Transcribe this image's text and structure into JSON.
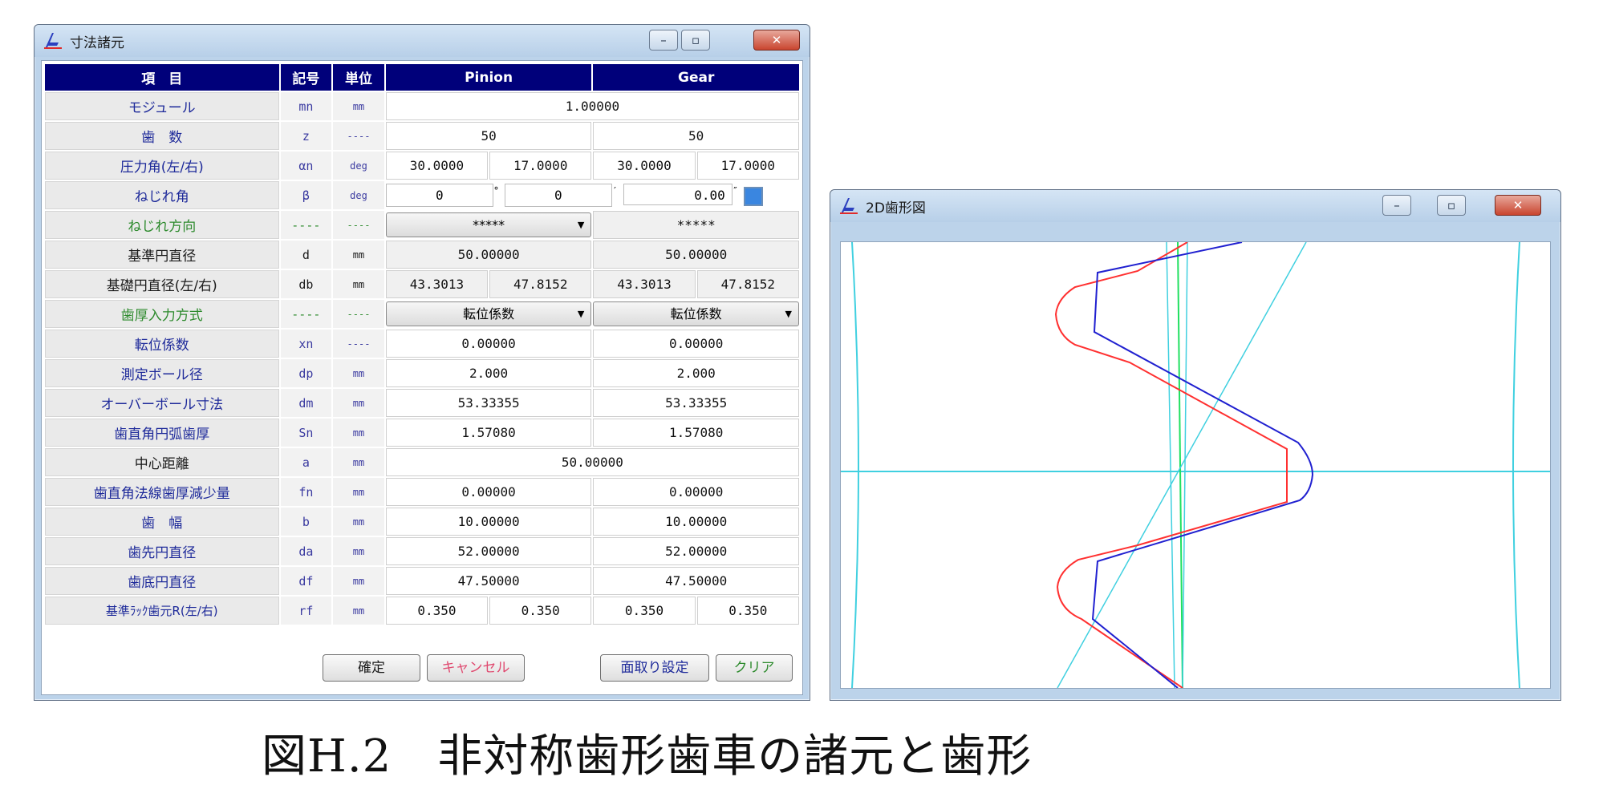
{
  "dim_window": {
    "title": "寸法諸元",
    "header": {
      "item": "項　目",
      "symbol": "記号",
      "unit": "単位",
      "pinion": "Pinion",
      "gear": "Gear"
    },
    "rows": [
      {
        "item": "モジュール",
        "sym": "mn",
        "unit": "mm",
        "span": "1.00000"
      },
      {
        "item": "歯　数",
        "sym": "z",
        "unit": "----",
        "pinion": "50",
        "gear": "50"
      },
      {
        "item": "圧力角(左/右)",
        "sym": "αn",
        "unit": "deg",
        "p_left": "30.0000",
        "p_right": "17.0000",
        "g_left": "30.0000",
        "g_right": "17.0000"
      },
      {
        "item": "ねじれ角",
        "sym": "β",
        "unit": "deg",
        "v1": "0",
        "v2": "0",
        "v3": "0.00"
      },
      {
        "item": "ねじれ方向",
        "sym": "----",
        "unit": "----",
        "pinion": "*****",
        "gear": "*****"
      },
      {
        "item": "基準円直径",
        "sym": "d",
        "unit": "mm",
        "pinion": "50.00000",
        "gear": "50.00000"
      },
      {
        "item": "基礎円直径(左/右)",
        "sym": "db",
        "unit": "mm",
        "p_left": "43.3013",
        "p_right": "47.8152",
        "g_left": "43.3013",
        "g_right": "47.8152"
      },
      {
        "item": "歯厚入力方式",
        "sym": "----",
        "unit": "----",
        "pinion": "転位係数",
        "gear": "転位係数"
      },
      {
        "item": "転位係数",
        "sym": "xn",
        "unit": "----",
        "pinion": "0.00000",
        "gear": "0.00000"
      },
      {
        "item": "測定ボール径",
        "sym": "dp",
        "unit": "mm",
        "pinion": "2.000",
        "gear": "2.000"
      },
      {
        "item": "オーバーボール寸法",
        "sym": "dm",
        "unit": "mm",
        "pinion": "53.33355",
        "gear": "53.33355"
      },
      {
        "item": "歯直角円弧歯厚",
        "sym": "Sn",
        "unit": "mm",
        "pinion": "1.57080",
        "gear": "1.57080"
      },
      {
        "item": "中心距離",
        "sym": "a",
        "unit": "mm",
        "span": "50.00000"
      },
      {
        "item": "歯直角法線歯厚減少量",
        "sym": "fn",
        "unit": "mm",
        "pinion": "0.00000",
        "gear": "0.00000"
      },
      {
        "item": "歯　幅",
        "sym": "b",
        "unit": "mm",
        "pinion": "10.00000",
        "gear": "10.00000"
      },
      {
        "item": "歯先円直径",
        "sym": "da",
        "unit": "mm",
        "pinion": "52.00000",
        "gear": "52.00000"
      },
      {
        "item": "歯底円直径",
        "sym": "df",
        "unit": "mm",
        "pinion": "47.50000",
        "gear": "47.50000"
      },
      {
        "item": "基準ﾗｯｸ歯元R(左/右)",
        "sym": "rf",
        "unit": "mm",
        "p_left": "0.350",
        "p_right": "0.350",
        "g_left": "0.350",
        "g_right": "0.350"
      }
    ],
    "buttons": {
      "ok": "確定",
      "cancel": "キャンセル",
      "chamfer": "面取り設定",
      "clear": "クリア"
    }
  },
  "profile_window": {
    "title": "2D歯形図"
  },
  "caption": "図H.2　非対称歯形歯車の諸元と歯形",
  "colors": {
    "header_bg": "#00007a",
    "item_text": "#1e2a9a",
    "green_text": "#2e8b2e",
    "pinion_curve": "#ff3030",
    "gear_curve": "#2020d0",
    "axis": "#40d0e0",
    "pitch_line": "#20e060"
  }
}
